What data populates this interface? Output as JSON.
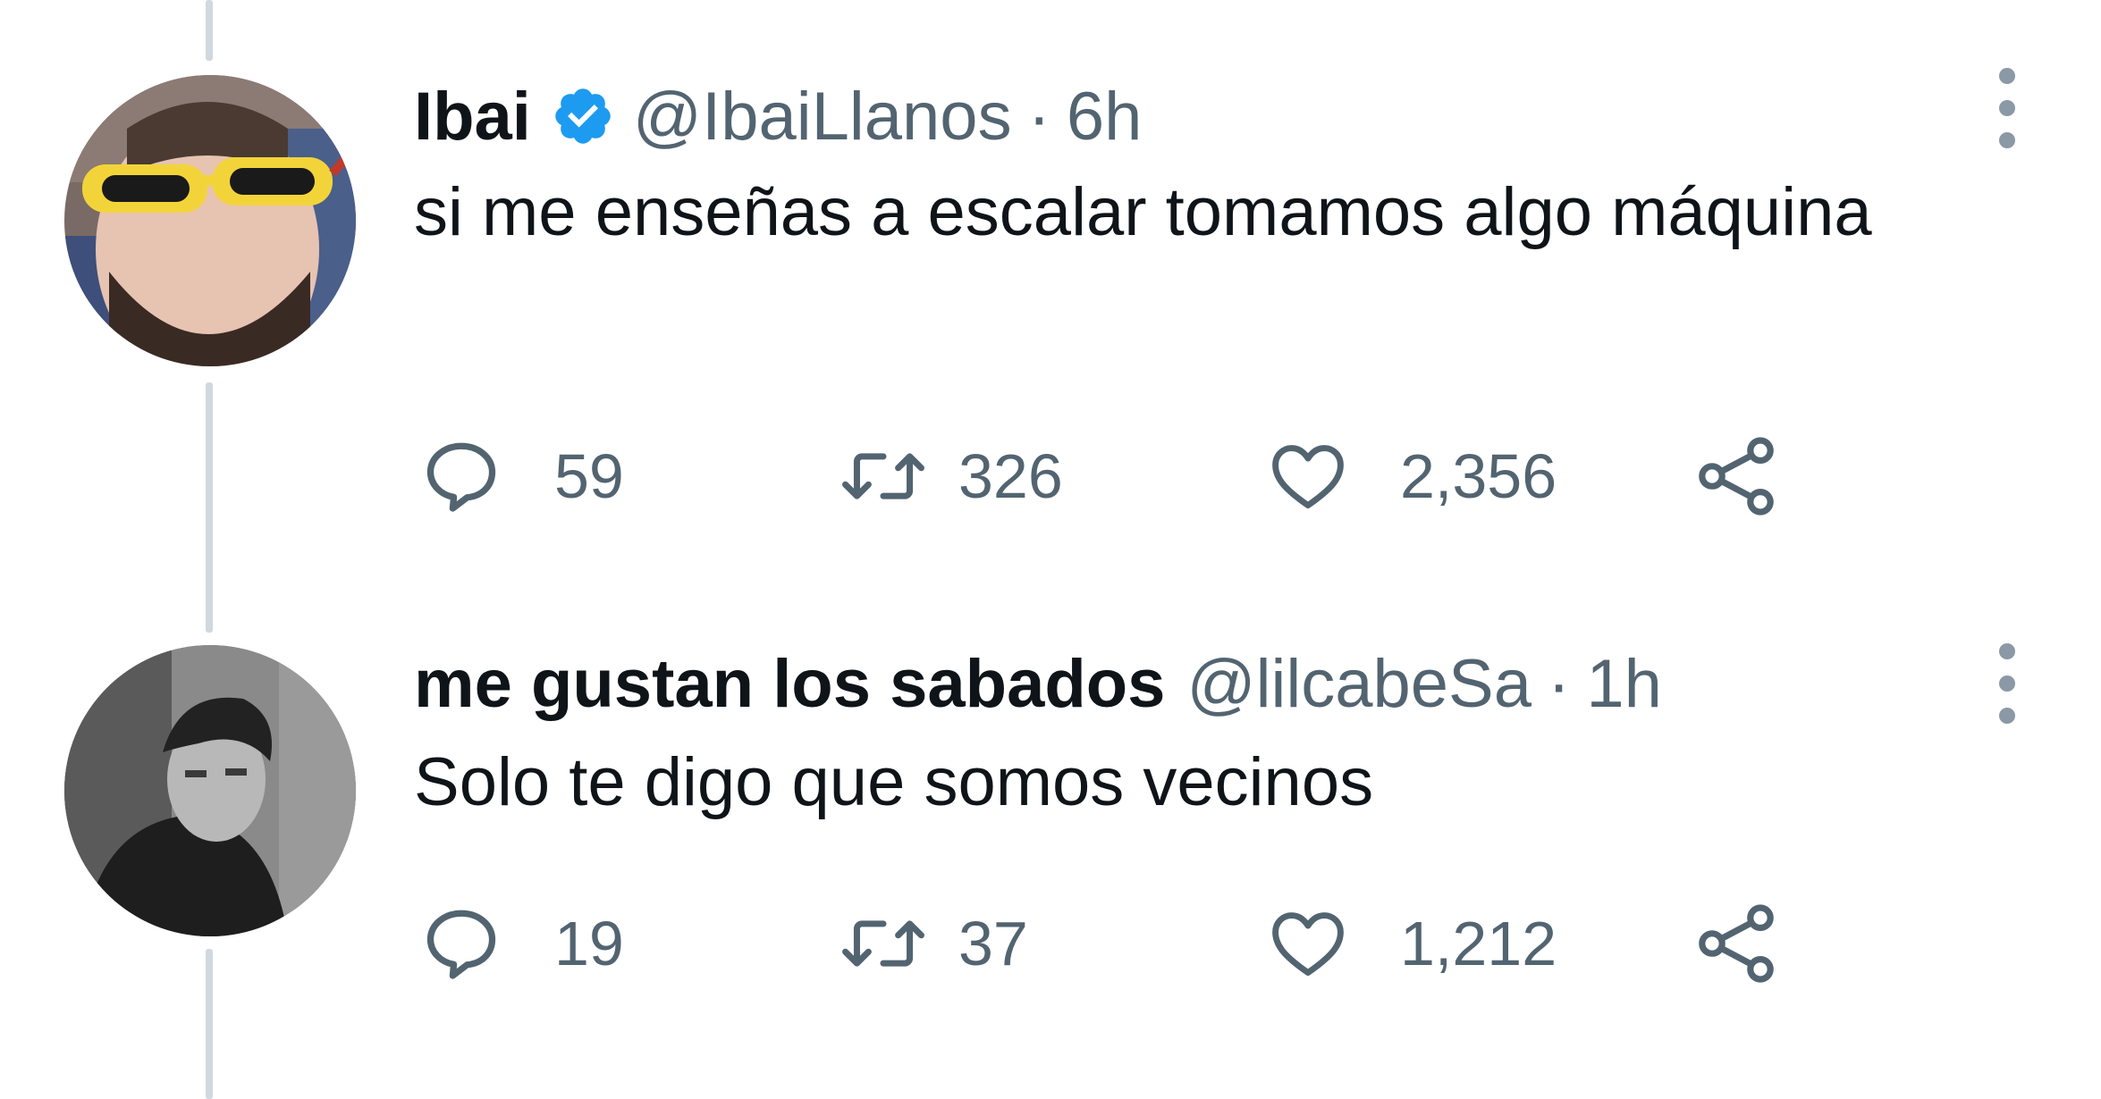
{
  "tweets": [
    {
      "display_name": "Ibai",
      "verified": true,
      "handle": "@IbaiLlanos",
      "separator": "·",
      "time": "6h",
      "text": "si me enseñas a escalar tomamos algo máquina",
      "replies": "59",
      "retweets": "326",
      "likes": "2,356"
    },
    {
      "display_name": "me gustan los sabados",
      "verified": false,
      "handle": "@lilcabeSa",
      "separator": "·",
      "time": "1h",
      "text": "Solo te digo que somos vecinos",
      "replies": "19",
      "retweets": "37",
      "likes": "1,212"
    }
  ],
  "icons": {
    "reply": "reply-icon",
    "retweet": "retweet-icon",
    "like": "heart-icon",
    "share": "share-icon",
    "more": "more-options-icon",
    "verified": "verified-badge-icon"
  },
  "colors": {
    "text_primary": "#0f1419",
    "text_secondary": "#536471",
    "verified_blue": "#1d9bf0",
    "thread_line": "#cfd9de"
  }
}
